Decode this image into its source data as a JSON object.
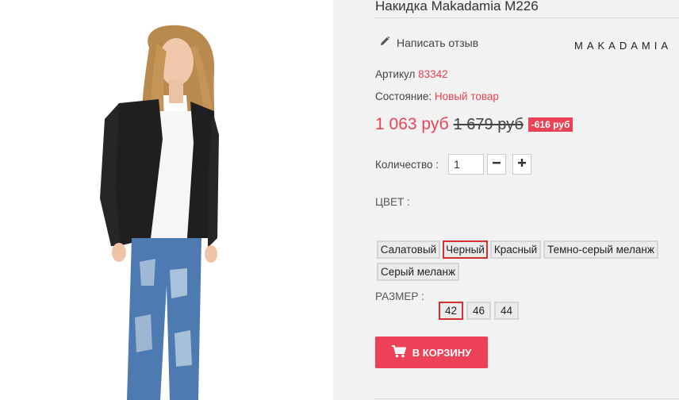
{
  "product": {
    "title": "Накидка Makadamia M226",
    "review_link": "Написать отзыв",
    "brand_logo": "MAKADAMIA",
    "article_label": "Артикул",
    "article_value": "83342",
    "condition_label": "Состояние:",
    "condition_value": "Новый товар",
    "price_new": "1 063 руб",
    "price_old": "1 679 руб",
    "discount": "-616 руб"
  },
  "quantity": {
    "label": "Количество :",
    "value": "1",
    "minus_icon": "minus-icon",
    "plus_icon": "plus-icon"
  },
  "color": {
    "label": "ЦВЕТ :",
    "options": [
      "Салатовый",
      "Черный",
      "Красный",
      "Темно-серый меланж",
      "Серый меланж"
    ],
    "selected": "Черный"
  },
  "size": {
    "label": "РАЗМЕР :",
    "options": [
      "42",
      "46",
      "44"
    ],
    "selected": "42"
  },
  "cart": {
    "label": "В КОРЗИНУ",
    "icon": "cart-icon"
  },
  "colors": {
    "accent": "#ec4157",
    "selected_border": "#d62f2f",
    "panel_bg": "#f2f2f2"
  }
}
